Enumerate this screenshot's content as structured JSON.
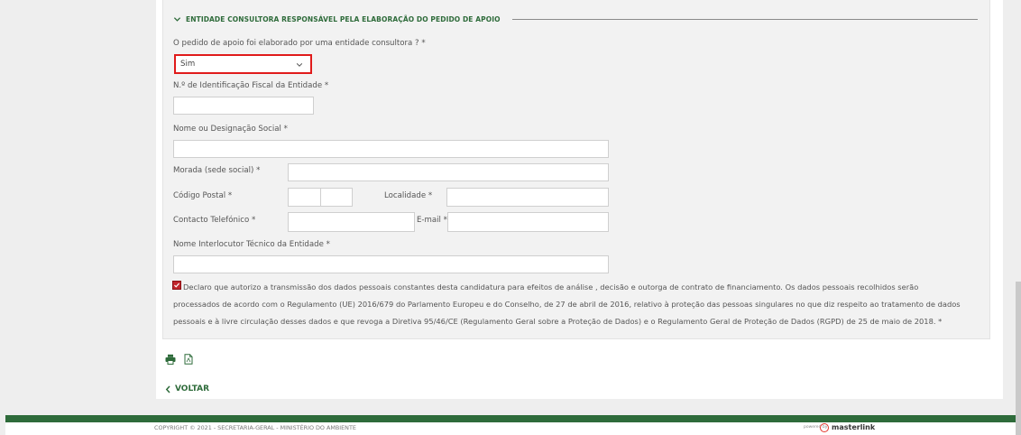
{
  "section": {
    "legend": "ENTIDADE CONSULTORA RESPONSÁVEL PELA ELABORAÇÃO DO PEDIDO DE APOIO"
  },
  "fields": {
    "consultora_question": "O pedido de apoio foi elaborado por uma entidade consultora ? *",
    "consultora_value": "Sim",
    "nif_label": "N.º de Identificação Fiscal da Entidade *",
    "nif_value": "",
    "nome_label": "Nome ou Designação Social *",
    "nome_value": "",
    "morada_label": "Morada (sede social) *",
    "morada_value": "",
    "codigo_postal_label": "Código Postal *",
    "localidade_label": "Localidade *",
    "contacto_label": "Contacto Telefónico *",
    "email_label": "E-mail *",
    "interlocutor_label": "Nome Interlocutor Técnico da Entidade *"
  },
  "declaration": {
    "checked": true,
    "line1": "Declaro que autorizo a transmissão dos dados pessoais constantes desta candidatura para efeitos de análise , decisão e outorga de contrato de financiamento. Os dados pessoais recolhidos serão",
    "line2": "processados de acordo com o Regulamento (UE) 2016/679 do Parlamento Europeu e do Conselho, de 27 de abril de 2016, relativo à proteção das pessoas singulares no que diz respeito ao tratamento de dados",
    "line3": "pessoais e à livre circulação desses dados e que revoga a Diretiva 95/46/CE (Regulamento Geral sobre a Proteção de Dados) e o Regulamento Geral de Proteção de Dados (RGPD) de 25 de maio de 2018. *"
  },
  "actions": {
    "print_icon": "print-icon",
    "pdf_icon": "pdf-icon",
    "back_label": "VOLTAR"
  },
  "footer": {
    "copyright": "COPYRIGHT © 2021 - SECRETARIA-GERAL - MINISTÉRIO DO AMBIENTE",
    "powered_by": "powered by",
    "brand": "masterlink"
  },
  "colors": {
    "brand_green": "#2e6b3a",
    "highlight_red": "#e01b1b",
    "panel_bg": "#f2f2f2"
  }
}
